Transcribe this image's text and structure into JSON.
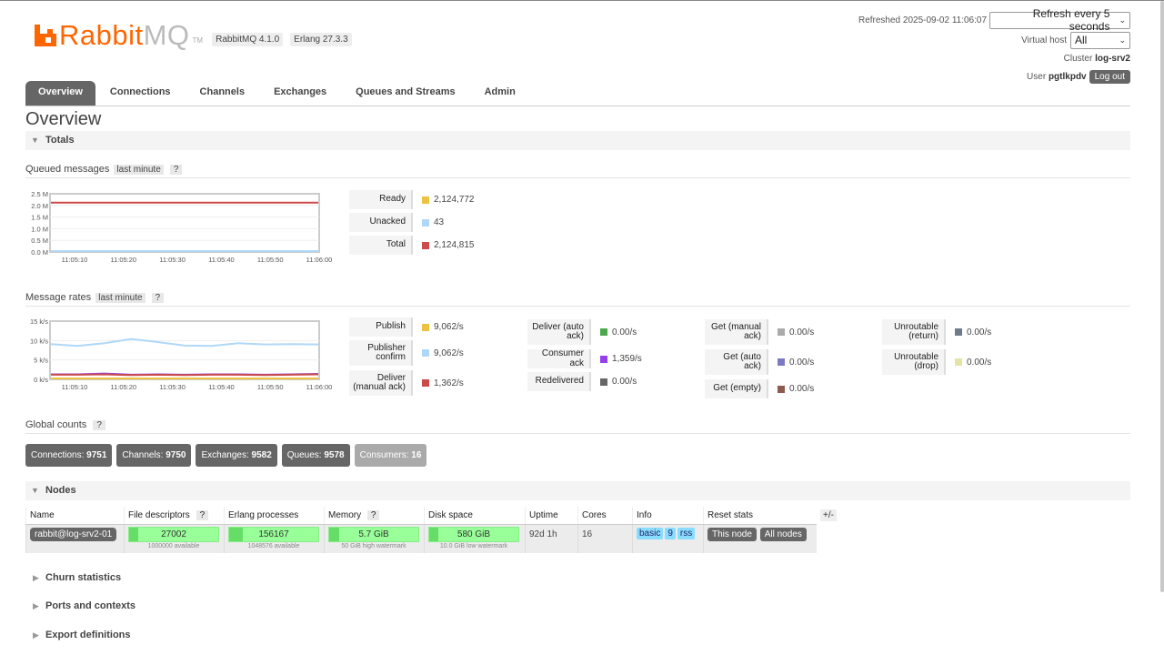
{
  "header": {
    "logo_text_a": "Rabbit",
    "logo_text_b": "MQ",
    "logo_tm": "TM",
    "version_rabbit": "RabbitMQ 4.1.0",
    "version_erlang": "Erlang 27.3.3",
    "refreshed_label": "Refreshed 2025-09-02 11:06:07",
    "refresh_select": "Refresh every 5 seconds",
    "vhost_label": "Virtual host",
    "vhost_select": "All",
    "cluster_label": "Cluster",
    "cluster_name": "log-srv2",
    "user_label": "User",
    "user_name": "pgtlkpdv",
    "logout_label": "Log out"
  },
  "tabs": [
    "Overview",
    "Connections",
    "Channels",
    "Exchanges",
    "Queues and Streams",
    "Admin"
  ],
  "page_title": "Overview",
  "totals_title": "Totals",
  "queued": {
    "title": "Queued messages",
    "range_tag": "last minute",
    "help": "?",
    "stats": [
      {
        "label": "Ready",
        "value": "2,124,772",
        "color": "#edc240"
      },
      {
        "label": "Unacked",
        "value": "43",
        "color": "#afd8f8"
      },
      {
        "label": "Total",
        "value": "2,124,815",
        "color": "#cb4b4b"
      }
    ]
  },
  "rates": {
    "title": "Message rates",
    "range_tag": "last minute",
    "help": "?",
    "col1": [
      {
        "label": "Publish",
        "value": "9,062/s",
        "color": "#edc240"
      },
      {
        "label": "Publisher confirm",
        "value": "9,062/s",
        "color": "#afd8f8"
      },
      {
        "label": "Deliver (manual ack)",
        "value": "1,362/s",
        "color": "#cb4b4b"
      }
    ],
    "col2": [
      {
        "label": "Deliver (auto ack)",
        "value": "0.00/s",
        "color": "#4da74d"
      },
      {
        "label": "Consumer ack",
        "value": "1,359/s",
        "color": "#9440ed"
      },
      {
        "label": "Redelivered",
        "value": "0.00/s",
        "color": "#666666"
      }
    ],
    "col3": [
      {
        "label": "Get (manual ack)",
        "value": "0.00/s",
        "color": "#aaaaaa"
      },
      {
        "label": "Get (auto ack)",
        "value": "0.00/s",
        "color": "#7c79c3"
      },
      {
        "label": "Get (empty)",
        "value": "0.00/s",
        "color": "#8d5a4f"
      }
    ],
    "col4": [
      {
        "label": "Unroutable (return)",
        "value": "0.00/s",
        "color": "#6e7b8b"
      },
      {
        "label": "Unroutable (drop)",
        "value": "0.00/s",
        "color": "#e4e4a8"
      }
    ]
  },
  "global_counts": {
    "title": "Global counts",
    "help": "?",
    "items": [
      {
        "label": "Connections:",
        "value": "9751"
      },
      {
        "label": "Channels:",
        "value": "9750"
      },
      {
        "label": "Exchanges:",
        "value": "9582"
      },
      {
        "label": "Queues:",
        "value": "9578"
      },
      {
        "label": "Consumers:",
        "value": "16"
      }
    ]
  },
  "nodes": {
    "title": "Nodes",
    "columns": [
      "Name",
      "File descriptors",
      "Erlang processes",
      "Memory",
      "Disk space",
      "Uptime",
      "Cores",
      "Info",
      "Reset stats"
    ],
    "help": "?",
    "plusminus": "+/-",
    "row": {
      "name": "rabbit@log-srv2-01",
      "fd_value": "27002",
      "fd_sub": "1000000 available",
      "fd_fraction": 0.027,
      "proc_value": "156167",
      "proc_sub": "1048576 available",
      "proc_fraction": 0.149,
      "mem_value": "5.7 GiB",
      "mem_sub": "50 GiB high watermark",
      "mem_fraction": 0.114,
      "disk_value": "580 GiB",
      "disk_sub": "10.0 GiB low watermark",
      "disk_fraction": 0.02,
      "uptime": "92d 1h",
      "cores": "16",
      "info_tags": [
        "basic",
        "9",
        "rss"
      ],
      "reset_this": "This node",
      "reset_all": "All nodes"
    }
  },
  "collapsed_sections": [
    "Churn statistics",
    "Ports and contexts",
    "Export definitions"
  ],
  "chart_data": [
    {
      "type": "line",
      "title": "Queued messages",
      "x": [
        "11:05:10",
        "11:05:20",
        "11:05:30",
        "11:05:40",
        "11:05:50",
        "11:06:00"
      ],
      "ylim": [
        0,
        2.5
      ],
      "yticks": [
        "2.5 M",
        "2.0 M",
        "1.5 M",
        "1.0 M",
        "0.5 M",
        "0.0 M"
      ],
      "series": [
        {
          "name": "Total",
          "color": "#cb4b4b",
          "values": [
            2.12,
            2.12,
            2.12,
            2.12,
            2.12,
            2.12,
            2.12
          ]
        },
        {
          "name": "Unacked",
          "color": "#afd8f8",
          "values": [
            0.0,
            0.0,
            0.0,
            0.0,
            0.0,
            0.0,
            0.0
          ]
        }
      ]
    },
    {
      "type": "line",
      "title": "Message rates",
      "x": [
        "11:05:10",
        "11:05:20",
        "11:05:30",
        "11:05:40",
        "11:05:50",
        "11:06:00"
      ],
      "ylim": [
        0,
        15
      ],
      "yticks": [
        "15 k/s",
        "10 k/s",
        "5 k/s",
        "0 k/s"
      ],
      "series": [
        {
          "name": "Publisher confirm",
          "color": "#afd8f8",
          "values": [
            9.1,
            8.6,
            9.3,
            10.4,
            9.6,
            8.7,
            8.6,
            9.3,
            9.0,
            9.1,
            9.0
          ]
        },
        {
          "name": "Consumer ack",
          "color": "#9440ed",
          "values": [
            1.3,
            1.3,
            1.5,
            1.2,
            1.3,
            1.2,
            1.3,
            1.3,
            1.2,
            1.3,
            1.4
          ]
        },
        {
          "name": "Deliver (manual ack)",
          "color": "#cb4b4b",
          "values": [
            1.2,
            1.2,
            1.3,
            1.1,
            1.2,
            1.1,
            1.2,
            1.2,
            1.1,
            1.2,
            1.3
          ]
        },
        {
          "name": "Publish",
          "color": "#edc240",
          "values": [
            0.2,
            0.2,
            0.2,
            0.2,
            0.2,
            0.2,
            0.2,
            0.2,
            0.2,
            0.2,
            0.2
          ]
        }
      ]
    }
  ]
}
